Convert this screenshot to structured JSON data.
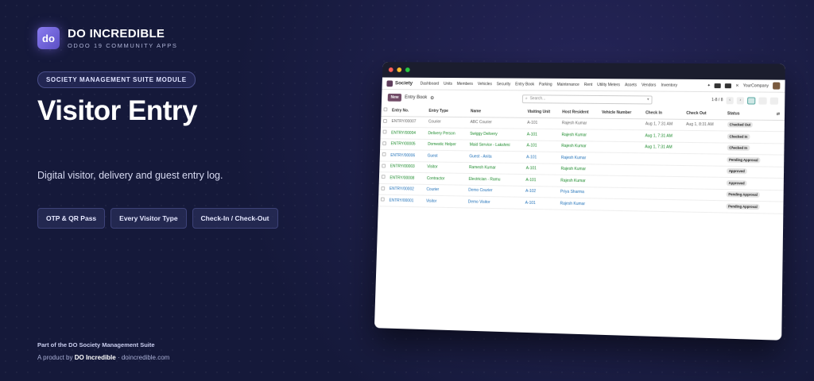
{
  "brand": {
    "logo": "do",
    "name": "DO INCREDIBLE",
    "sub": "ODOO 19 COMMUNITY APPS"
  },
  "module_badge": "SOCIETY MANAGEMENT SUITE MODULE",
  "title": "Visitor Entry",
  "tagline": "Digital visitor, delivery and guest entry log.",
  "pills": [
    "OTP & QR Pass",
    "Every Visitor Type",
    "Check-In / Check-Out"
  ],
  "footer": {
    "line1": "Part of the DO Society Management Suite",
    "line2_prefix": "A product by",
    "line2_brand": "DO Incredible",
    "line2_suffix": "· doincredible.com"
  },
  "app": {
    "name": "Society",
    "menu": [
      "Dashboard",
      "Units",
      "Members",
      "Vehicles",
      "Security",
      "Entry Book",
      "Parking",
      "Maintenance",
      "Rent",
      "Utility Meters",
      "Assets",
      "Vendors",
      "Inventory"
    ],
    "company": "YourCompany",
    "new_label": "New",
    "breadcrumb": "Entry Book",
    "search_placeholder": "Search...",
    "pager": "1-8 / 8",
    "columns": [
      "Entry No.",
      "Entry Type",
      "Name",
      "Visiting Unit",
      "Host Resident",
      "Vehicle Number",
      "Check In",
      "Check Out",
      "Status"
    ],
    "rows": [
      {
        "entry": "ENTRY/00007",
        "type": "Courier",
        "name": "ABC Courier",
        "unit": "A-101",
        "host": "Rajesh Kumar",
        "vehicle": "",
        "in": "Aug 1, 7:31 AM",
        "out": "Aug 1, 8:31 AM",
        "status": "Checked Out",
        "tone": "grey"
      },
      {
        "entry": "ENTRY/00004",
        "type": "Delivery Person",
        "name": "Swiggy Delivery",
        "unit": "A-101",
        "host": "Rajesh Kumar",
        "vehicle": "",
        "in": "Aug 1, 7:31 AM",
        "out": "",
        "status": "Checked In",
        "tone": "green"
      },
      {
        "entry": "ENTRY/00005",
        "type": "Domestic Helper",
        "name": "Maid Service - Lakshmi",
        "unit": "A-101",
        "host": "Rajesh Kumar",
        "vehicle": "",
        "in": "Aug 1, 7:31 AM",
        "out": "",
        "status": "Checked In",
        "tone": "green"
      },
      {
        "entry": "ENTRY/00006",
        "type": "Guest",
        "name": "Guest - Anita",
        "unit": "A-101",
        "host": "Rajesh Kumar",
        "vehicle": "",
        "in": "",
        "out": "",
        "status": "Pending Approval",
        "tone": "blue"
      },
      {
        "entry": "ENTRY/00003",
        "type": "Visitor",
        "name": "Ramesh Kumar",
        "unit": "A-101",
        "host": "Rajesh Kumar",
        "vehicle": "",
        "in": "",
        "out": "",
        "status": "Approved",
        "tone": "green"
      },
      {
        "entry": "ENTRY/00008",
        "type": "Contractor",
        "name": "Electrician - Ramu",
        "unit": "A-101",
        "host": "Rajesh Kumar",
        "vehicle": "",
        "in": "",
        "out": "",
        "status": "Approved",
        "tone": "green"
      },
      {
        "entry": "ENTRY/00002",
        "type": "Courier",
        "name": "Demo Courier",
        "unit": "A-102",
        "host": "Priya Sharma",
        "vehicle": "",
        "in": "",
        "out": "",
        "status": "Pending Approval",
        "tone": "blue"
      },
      {
        "entry": "ENTRY/00001",
        "type": "Visitor",
        "name": "Demo Visitor",
        "unit": "A-101",
        "host": "Rajesh Kumar",
        "vehicle": "",
        "in": "",
        "out": "",
        "status": "Pending Approval",
        "tone": "blue"
      }
    ]
  }
}
